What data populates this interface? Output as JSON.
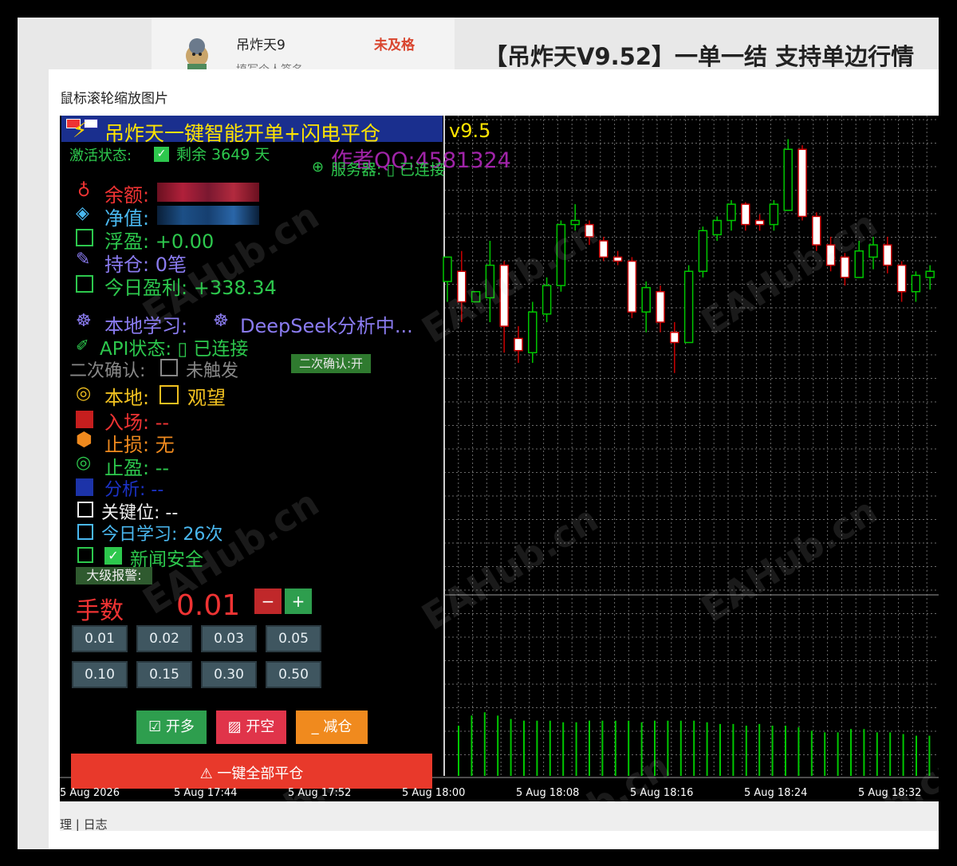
{
  "background_page": {
    "username": "吊炸天9",
    "status": "未及格",
    "subtitle": "填写个人签名",
    "headline": "【吊炸天V9.52】一单一结 支持单边行情"
  },
  "modal": {
    "title": "鼠标滚轮缩放图片"
  },
  "panel": {
    "title": "吊炸天一键智能开单+闪电平仓",
    "version": "v9.5",
    "activation_label": "激活状态:",
    "activation_rest": "剩余 3649 天",
    "author": "作者QQ:4581324",
    "server": "服务器: ▯ 已连接",
    "balance_label": "余额:",
    "equity_label": "净值:",
    "floating_label": "浮盈: +0.00",
    "positions_label": "持仓: 0笔",
    "today_profit_label": "今日盈利: +338.34",
    "learning_label": "本地学习:",
    "learning_value": "DeepSeek分析中...",
    "api_label": "API状态: ▯ 已连接",
    "confirm_label": "二次确认:",
    "confirm_value": "未触发",
    "confirm_button": "二次确认:开",
    "local_label": "本地:",
    "local_value": "观望",
    "entry_label": "入场: --",
    "stoploss_label": "止损: 无",
    "takeprofit_label": "止盈: --",
    "analysis_label": "分析: --",
    "keylevel_label": "关键位: --",
    "today_learn_label": "今日学习: 26次",
    "news_label": "新闻安全",
    "alert_label": "大级报警:",
    "lots_label": "手数",
    "lots_value": "0.01",
    "minus_label": "−",
    "plus_label": "+",
    "lot_presets": [
      "0.01",
      "0.02",
      "0.03",
      "0.05",
      "0.10",
      "0.15",
      "0.30",
      "0.50"
    ],
    "buy_label": "开多",
    "sell_label": "开空",
    "reduce_label": "减仓",
    "close_all_label": "一键全部平仓"
  },
  "watermark": "EAHub.cn",
  "time_axis": [
    "5 Aug 2026",
    "5 Aug 17:44",
    "5 Aug 17:52",
    "5 Aug 18:00",
    "5 Aug 18:08",
    "5 Aug 18:16",
    "5 Aug 18:24",
    "5 Aug 18:32"
  ],
  "bottom_tabs": "理 | 日志",
  "colors": {
    "bull": "#00c800",
    "bear": "#ffffff",
    "grid": "#6a6a6a",
    "volume": "#00c800",
    "close_all": "#e8392b",
    "buy": "#2e9e4e",
    "sell": "#e0344a",
    "reduce": "#f08a1e"
  },
  "chart_data": {
    "type": "candlestick",
    "candles": [
      {
        "o": 40,
        "c": 52,
        "h": 40,
        "l": 30
      },
      {
        "o": 45,
        "c": 30,
        "h": 55,
        "l": 20
      },
      {
        "o": 30,
        "c": 35,
        "h": 25,
        "l": 50
      },
      {
        "o": 32,
        "c": 48,
        "h": 60,
        "l": 20
      },
      {
        "o": 48,
        "c": 18,
        "h": 50,
        "l": 5
      },
      {
        "o": 12,
        "c": 6,
        "h": 18,
        "l": 0
      },
      {
        "o": 5,
        "c": 25,
        "h": 30,
        "l": 0
      },
      {
        "o": 24,
        "c": 38,
        "h": 42,
        "l": 20
      },
      {
        "o": 38,
        "c": 68,
        "h": 70,
        "l": 35
      },
      {
        "o": 68,
        "c": 70,
        "h": 78,
        "l": 65
      },
      {
        "o": 68,
        "c": 62,
        "h": 70,
        "l": 58
      },
      {
        "o": 60,
        "c": 52,
        "h": 62,
        "l": 50
      },
      {
        "o": 52,
        "c": 50,
        "h": 55,
        "l": 48
      },
      {
        "o": 50,
        "c": 25,
        "h": 52,
        "l": 22
      },
      {
        "o": 25,
        "c": 37,
        "h": 40,
        "l": 15
      },
      {
        "o": 35,
        "c": 20,
        "h": 38,
        "l": 15
      },
      {
        "o": 15,
        "c": 10,
        "h": 20,
        "l": -5
      },
      {
        "o": 10,
        "c": 45,
        "h": 48,
        "l": 10
      },
      {
        "o": 45,
        "c": 65,
        "h": 67,
        "l": 42
      },
      {
        "o": 63,
        "c": 70,
        "h": 72,
        "l": 60
      },
      {
        "o": 70,
        "c": 78,
        "h": 80,
        "l": 65
      },
      {
        "o": 78,
        "c": 68,
        "h": 79,
        "l": 65
      },
      {
        "o": 70,
        "c": 68,
        "h": 73,
        "l": 65
      },
      {
        "o": 68,
        "c": 78,
        "h": 80,
        "l": 65
      },
      {
        "o": 75,
        "c": 105,
        "h": 110,
        "l": 75
      },
      {
        "o": 105,
        "c": 72,
        "h": 107,
        "l": 70
      },
      {
        "o": 72,
        "c": 58,
        "h": 74,
        "l": 55
      },
      {
        "o": 58,
        "c": 48,
        "h": 62,
        "l": 45
      },
      {
        "o": 52,
        "c": 42,
        "h": 54,
        "l": 38
      },
      {
        "o": 42,
        "c": 55,
        "h": 60,
        "l": 42
      },
      {
        "o": 52,
        "c": 58,
        "h": 62,
        "l": 46
      },
      {
        "o": 58,
        "c": 48,
        "h": 62,
        "l": 44
      },
      {
        "o": 48,
        "c": 35,
        "h": 50,
        "l": 30
      },
      {
        "o": 35,
        "c": 43,
        "h": 45,
        "l": 30
      },
      {
        "o": 42,
        "c": 45,
        "h": 48,
        "l": 36
      },
      {
        "o": 45,
        "c": 40,
        "h": 52,
        "l": 38
      }
    ],
    "volumes": [
      30,
      36,
      38,
      36,
      34,
      33,
      33,
      33,
      32,
      32,
      33,
      33,
      33,
      33,
      32,
      33,
      33,
      33,
      33,
      32,
      31,
      31,
      30,
      31,
      30,
      30,
      29,
      27,
      26,
      26,
      28,
      28,
      26,
      26,
      25,
      24,
      24,
      24
    ]
  }
}
